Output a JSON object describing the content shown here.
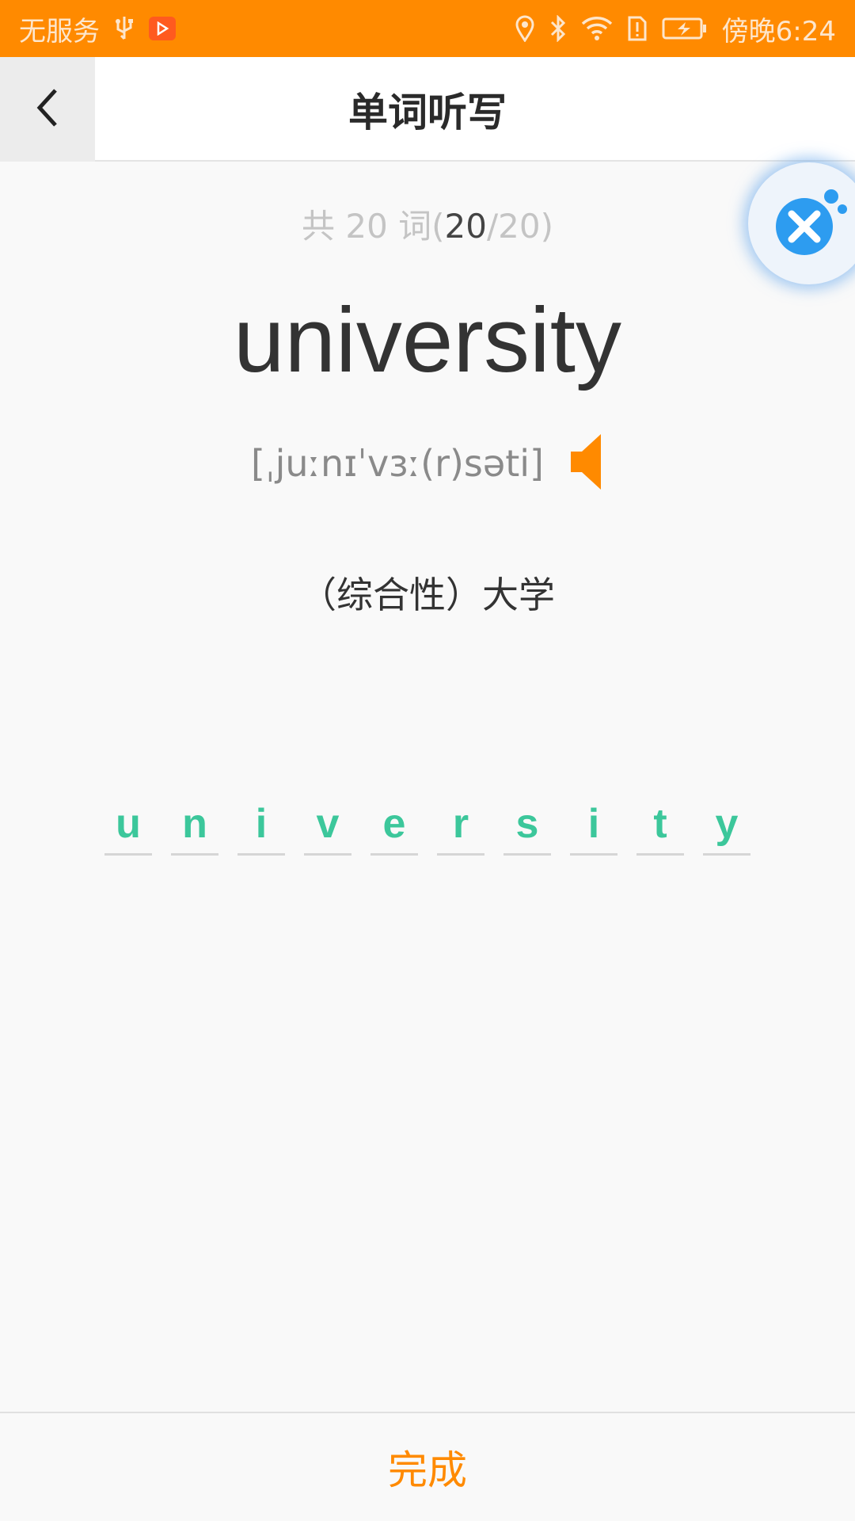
{
  "status_bar": {
    "carrier": "无服务",
    "time": "傍晚6:24"
  },
  "header": {
    "title": "单词听写"
  },
  "progress": {
    "prefix": "共 20 词(",
    "current": "20",
    "suffix": "/20)"
  },
  "word": {
    "text": "university",
    "phonetic": "[ˌjuːnɪˈvɜː(r)səti]",
    "meaning": "（综合性）大学"
  },
  "answer_letters": [
    "u",
    "n",
    "i",
    "v",
    "e",
    "r",
    "s",
    "i",
    "t",
    "y"
  ],
  "footer": {
    "done_label": "完成"
  },
  "colors": {
    "accent": "#ff8a00",
    "letter": "#3cc79b",
    "float_badge": "#2d9cf0"
  },
  "icons": [
    "usb-icon",
    "app-badge-icon",
    "location-icon",
    "bluetooth-icon",
    "wifi-icon",
    "sim-alert-icon",
    "battery-icon",
    "back-arrow-icon",
    "floating-assistant-icon",
    "speaker-icon"
  ]
}
